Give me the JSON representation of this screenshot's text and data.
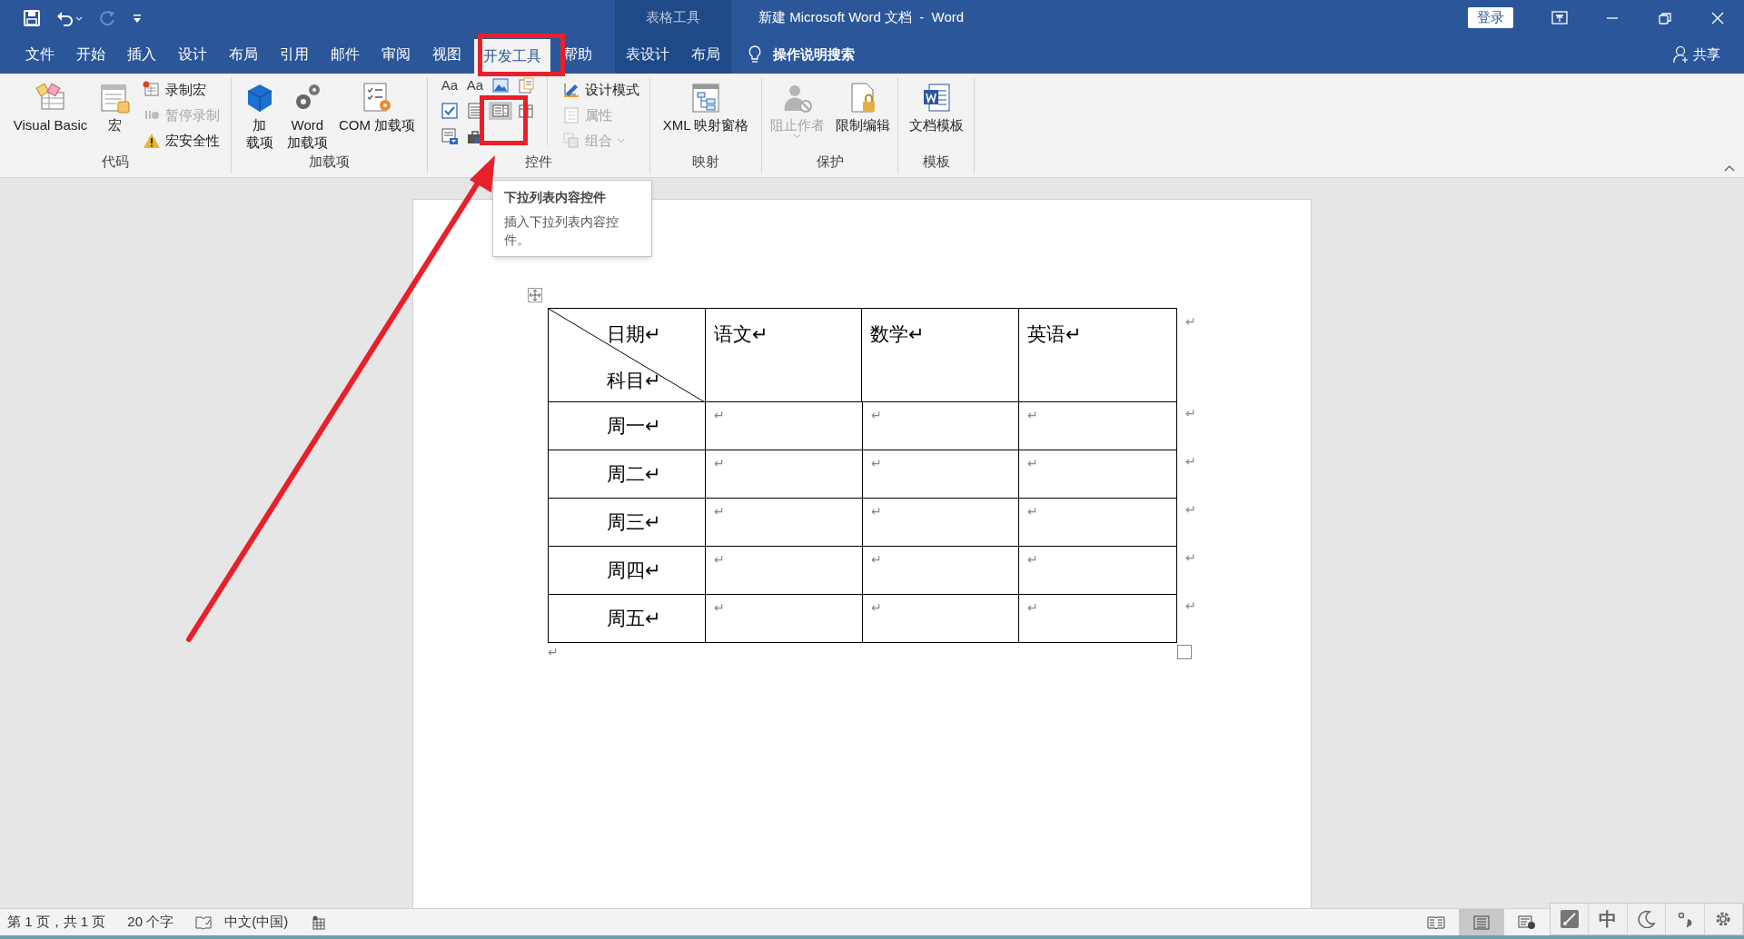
{
  "title_bar": {
    "context_group": "表格工具",
    "title": "新建 Microsoft Word 文档  -  Word",
    "login": "登录"
  },
  "tabs": [
    {
      "label": "文件",
      "selected": false,
      "contextual": false
    },
    {
      "label": "开始",
      "selected": false,
      "contextual": false
    },
    {
      "label": "插入",
      "selected": false,
      "contextual": false
    },
    {
      "label": "设计",
      "selected": false,
      "contextual": false
    },
    {
      "label": "布局",
      "selected": false,
      "contextual": false
    },
    {
      "label": "引用",
      "selected": false,
      "contextual": false
    },
    {
      "label": "邮件",
      "selected": false,
      "contextual": false
    },
    {
      "label": "审阅",
      "selected": false,
      "contextual": false
    },
    {
      "label": "视图",
      "selected": false,
      "contextual": false
    },
    {
      "label": "开发工具",
      "selected": true,
      "contextual": false
    },
    {
      "label": "帮助",
      "selected": false,
      "contextual": false
    },
    {
      "label": "表设计",
      "selected": false,
      "contextual": true
    },
    {
      "label": "布局",
      "selected": false,
      "contextual": true
    }
  ],
  "tell_me": "操作说明搜索",
  "share": "共享",
  "ribbon": {
    "groups": [
      {
        "name": "代码",
        "items": [
          {
            "kind": "large",
            "lines": [
              "Visual Basic"
            ],
            "disabled": false
          },
          {
            "kind": "large",
            "lines": [
              "宏"
            ],
            "disabled": false
          },
          {
            "kind": "small",
            "label": "录制宏",
            "disabled": false
          },
          {
            "kind": "small",
            "label": "暂停录制",
            "disabled": true
          },
          {
            "kind": "small",
            "label": "宏安全性",
            "disabled": false
          }
        ]
      },
      {
        "name": "加载项",
        "items": [
          {
            "kind": "large",
            "lines": [
              "加",
              "载项"
            ],
            "disabled": false
          },
          {
            "kind": "large",
            "lines": [
              "Word",
              "加载项"
            ],
            "disabled": false
          },
          {
            "kind": "large",
            "lines": [
              "COM 加载项"
            ],
            "disabled": false
          }
        ]
      },
      {
        "name": "控件",
        "items": [
          {
            "kind": "glyph",
            "glyph": "Aa",
            "highlighted": false
          },
          {
            "kind": "glyph",
            "glyph": "Aa",
            "highlighted": false
          },
          {
            "kind": "icon",
            "highlighted": false
          },
          {
            "kind": "icon",
            "highlighted": false
          },
          {
            "kind": "icon",
            "highlighted": false
          },
          {
            "kind": "icon",
            "highlighted": false
          },
          {
            "kind": "icon",
            "highlighted": true
          },
          {
            "kind": "icon",
            "highlighted": false
          },
          {
            "kind": "icon",
            "highlighted": false
          },
          {
            "kind": "icon",
            "highlighted": false
          },
          {
            "kind": "small",
            "label": "设计模式",
            "disabled": false
          },
          {
            "kind": "small",
            "label": "属性",
            "disabled": true
          },
          {
            "kind": "small",
            "label": "组合",
            "disabled": true
          }
        ]
      },
      {
        "name": "映射",
        "items": [
          {
            "kind": "large",
            "lines": [
              "XML 映射窗格"
            ],
            "disabled": false
          }
        ]
      },
      {
        "name": "保护",
        "items": [
          {
            "kind": "large",
            "lines": [
              "阻止作者"
            ],
            "disabled": true
          },
          {
            "kind": "large",
            "lines": [
              "限制编辑"
            ],
            "disabled": false
          }
        ]
      },
      {
        "name": "模板",
        "items": [
          {
            "kind": "large",
            "lines": [
              "文档模板"
            ],
            "disabled": false
          }
        ]
      }
    ]
  },
  "tooltip": {
    "title": "下拉列表内容控件",
    "text": "插入下拉列表内容控件。"
  },
  "table": {
    "columns": [
      "日期↵",
      "语文↵",
      "数学↵",
      "英语↵"
    ],
    "corner_lower": "科目↵",
    "header_end": "↵",
    "rows": [
      {
        "cells": [
          "周一↵",
          "↵",
          "↵",
          "↵"
        ],
        "end": "↵"
      },
      {
        "cells": [
          "周二↵",
          "↵",
          "↵",
          "↵"
        ],
        "end": "↵"
      },
      {
        "cells": [
          "周三↵",
          "↵",
          "↵",
          "↵"
        ],
        "end": "↵"
      },
      {
        "cells": [
          "周四↵",
          "↵",
          "↵",
          "↵"
        ],
        "end": "↵"
      },
      {
        "cells": [
          "周五↵",
          "↵",
          "↵",
          "↵"
        ],
        "end": "↵"
      }
    ],
    "after": "↵"
  },
  "status_bar": {
    "page": "第 1 页，共 1 页",
    "words": "20 个字",
    "language": "中文(中国)"
  },
  "ime_bar": {
    "mode": "中"
  }
}
